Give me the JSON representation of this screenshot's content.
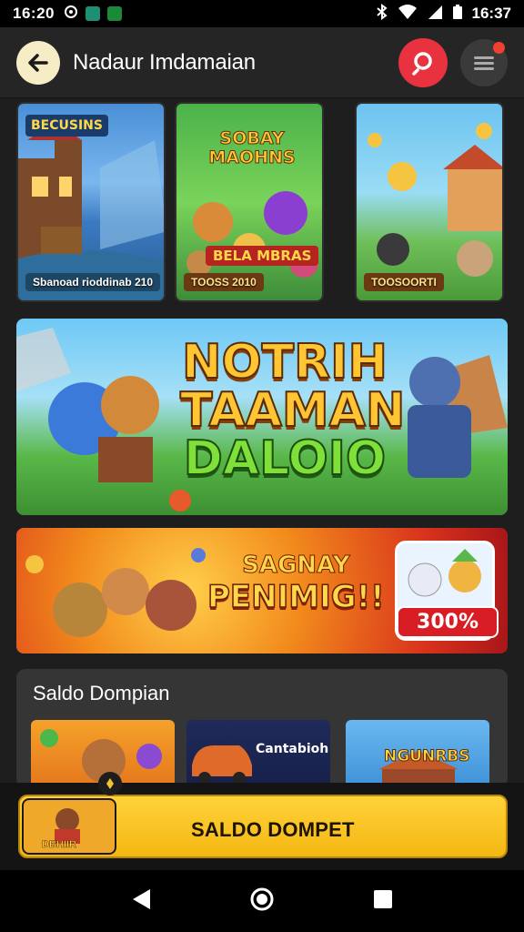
{
  "status_bar": {
    "time": "16:20",
    "right_time": "16:37",
    "icons": [
      "settings-icon",
      "phone-icon",
      "image-icon",
      "bluetooth-icon",
      "wifi-icon",
      "signal-icon",
      "battery-icon"
    ]
  },
  "header": {
    "title": "Nadaur Imdamaian",
    "back_icon": "arrow-left-icon",
    "search_icon": "search-icon",
    "menu_icon": "hamburger-menu-icon"
  },
  "top_cards": [
    {
      "title": "BECUSINS",
      "caption": "Sbanoad rioddinab 210"
    },
    {
      "title": "SOBAY MAOHNS",
      "subtitle": "BELA MBRAS",
      "caption": "TOOSS 2010"
    },
    {
      "title": "",
      "caption": "TOOSOORTI"
    }
  ],
  "hero_banner": {
    "line1": "NOTRIH",
    "line2": "TAAMAN",
    "line3": "DALOIO"
  },
  "promo_banner": {
    "line1": "SAGNAY",
    "line2": "PENIMIG!!",
    "badge_value": "300%"
  },
  "saldo_section": {
    "title": "Saldo Dompian",
    "thumbs": [
      {
        "label": ""
      },
      {
        "label": "Cantabioh"
      },
      {
        "label": "NGUNRBS"
      }
    ]
  },
  "action_bar": {
    "button_label": "SALDO DOMPET",
    "thumb_label": "DBHIIR"
  },
  "nav_bar": {
    "back": "back-triangle-icon",
    "home": "home-circle-icon",
    "recents": "recents-square-icon"
  },
  "colors": {
    "accent_red": "#e8323f",
    "cta_yellow": "#ffd23a",
    "background": "#1e1e1e"
  }
}
